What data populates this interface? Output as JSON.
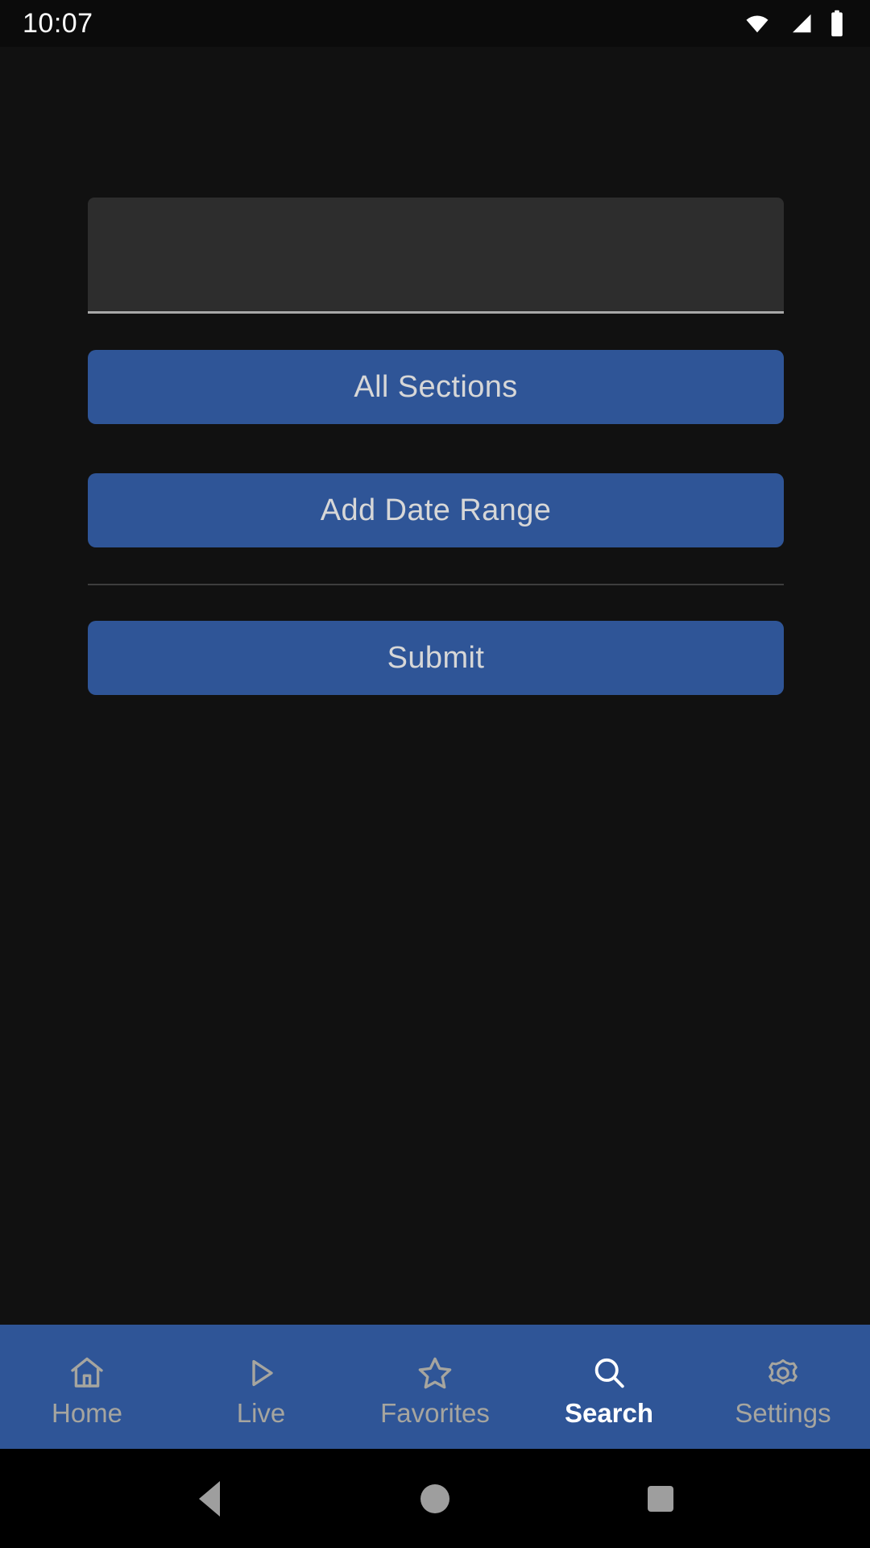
{
  "status_bar": {
    "clock": "10:07",
    "icons": [
      "wifi-icon",
      "cellular-signal-icon",
      "battery-icon"
    ]
  },
  "screen": {
    "title": "Search",
    "background_color": "#111111",
    "accent_color": "#2f5597"
  },
  "form": {
    "search_input": {
      "value": "",
      "placeholder": ""
    },
    "all_sections_label": "All Sections",
    "add_date_range_label": "Add Date Range",
    "submit_label": "Submit"
  },
  "bottom_nav": {
    "active": "Search",
    "items": [
      {
        "label": "Home",
        "icon": "home-icon",
        "active": false
      },
      {
        "label": "Live",
        "icon": "play-icon",
        "active": false
      },
      {
        "label": "Favorites",
        "icon": "star-icon",
        "active": false
      },
      {
        "label": "Search",
        "icon": "search-icon",
        "active": true
      },
      {
        "label": "Settings",
        "icon": "gear-icon",
        "active": false
      }
    ],
    "inactive_color": "#a6a59f",
    "active_color": "#ffffff"
  },
  "system_nav": {
    "buttons": [
      "back-button",
      "home-button",
      "recents-button"
    ]
  }
}
